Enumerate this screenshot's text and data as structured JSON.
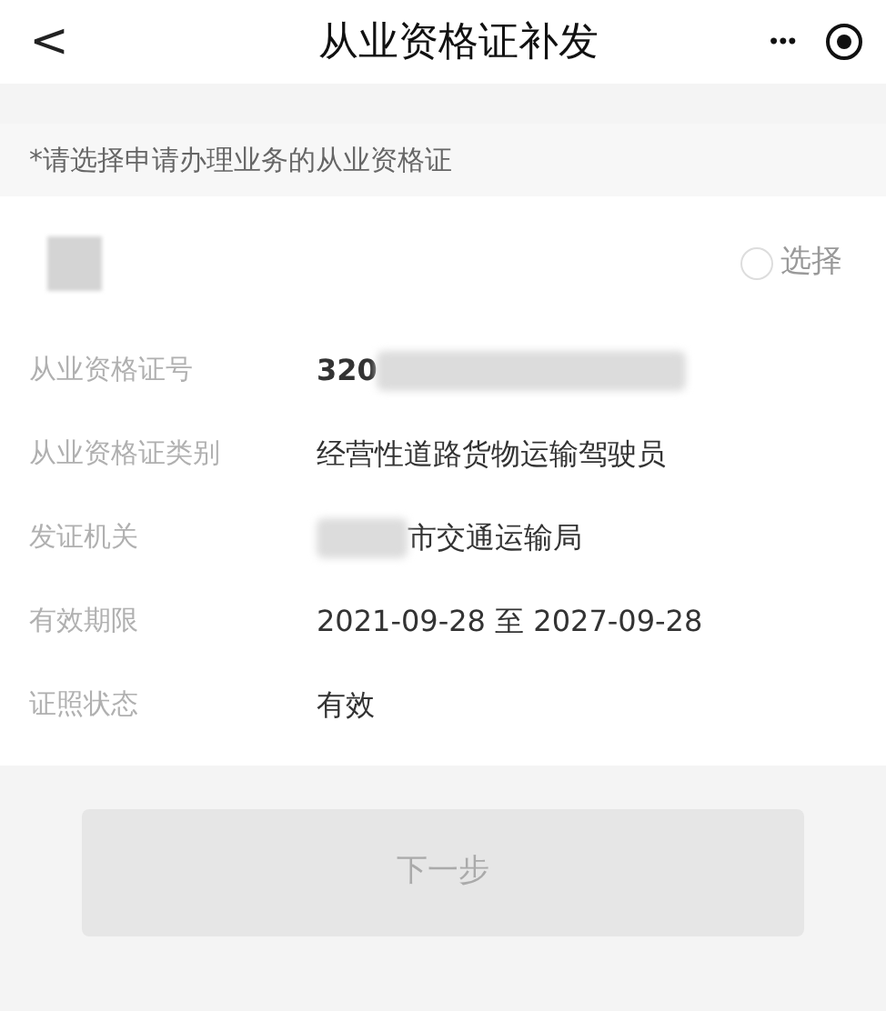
{
  "header": {
    "back": "<",
    "title": "从业资格证补发",
    "more": "•••"
  },
  "notice": "*请选择申请办理业务的从业资格证",
  "certificate": {
    "select_label": "选择",
    "selected": false,
    "fields": [
      {
        "label": "从业资格证号",
        "value": "320",
        "kind": "masked_end"
      },
      {
        "label": "从业资格证类别",
        "value": "经营性道路货物运输驾驶员",
        "kind": "plain"
      },
      {
        "label": "发证机关",
        "value": "市交通运输局",
        "kind": "masked_start"
      },
      {
        "label": "有效期限",
        "value": "2021-09-28 至 2027-09-28",
        "kind": "plain"
      },
      {
        "label": "证照状态",
        "value": "有效",
        "kind": "plain"
      }
    ]
  },
  "next_button": {
    "label": "下一步",
    "disabled": true
  }
}
